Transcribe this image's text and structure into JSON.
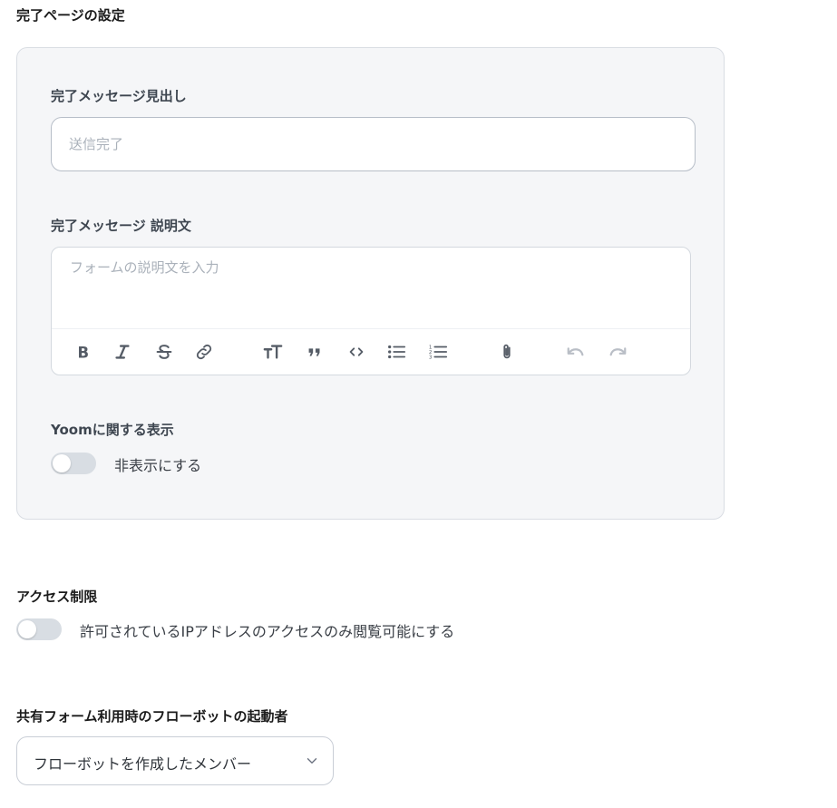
{
  "completion": {
    "section_title": "完了ページの設定",
    "heading_label": "完了メッセージ見出し",
    "heading_placeholder": "送信完了",
    "description_label": "完了メッセージ 説明文",
    "description_placeholder": "フォームの説明文を入力",
    "toolbar": [
      "bold-icon",
      "italic-icon",
      "strikethrough-icon",
      "link-icon",
      "text-size-icon",
      "quote-icon",
      "code-icon",
      "bullet-list-icon",
      "numbered-list-icon",
      "attachment-icon",
      "undo-icon",
      "redo-icon"
    ],
    "yoom_label": "Yoomに関する表示",
    "yoom_toggle_label": "非表示にする",
    "yoom_toggle_on": false
  },
  "access": {
    "section_title": "アクセス制限",
    "toggle_label": "許可されているIPアドレスのアクセスのみ閲覧可能にする",
    "toggle_on": false
  },
  "launcher": {
    "section_title": "共有フォーム利用時のフローボットの起動者",
    "selected": "フローボットを作成したメンバー"
  },
  "colors": {
    "panel_bg": "#f5f6f8",
    "toggle_off": "#d8dde3",
    "disabled_icon": "#b9bec6"
  }
}
